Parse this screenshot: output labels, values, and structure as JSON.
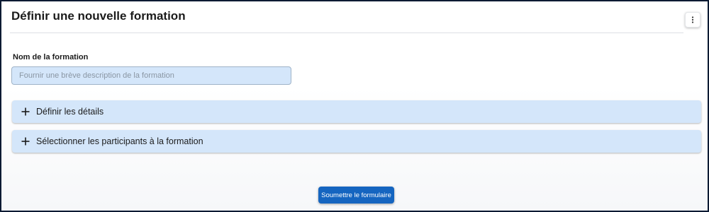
{
  "header": {
    "title": "Définir une nouvelle formation",
    "menu_icon": "more-vertical-icon"
  },
  "form": {
    "name_label": "Nom de la formation",
    "name_value": "",
    "name_placeholder": "Fournir une brève description de la formation"
  },
  "sections": [
    {
      "label": "Définir les détails",
      "icon": "plus-icon"
    },
    {
      "label": "Sélectionner les participants à la formation",
      "icon": "plus-icon"
    }
  ],
  "actions": {
    "submit_label": "Soumettre le formulaire"
  },
  "colors": {
    "accent": "#1565c0",
    "panel_bg": "#d4e6fa",
    "frame_border": "#0b1a33"
  }
}
